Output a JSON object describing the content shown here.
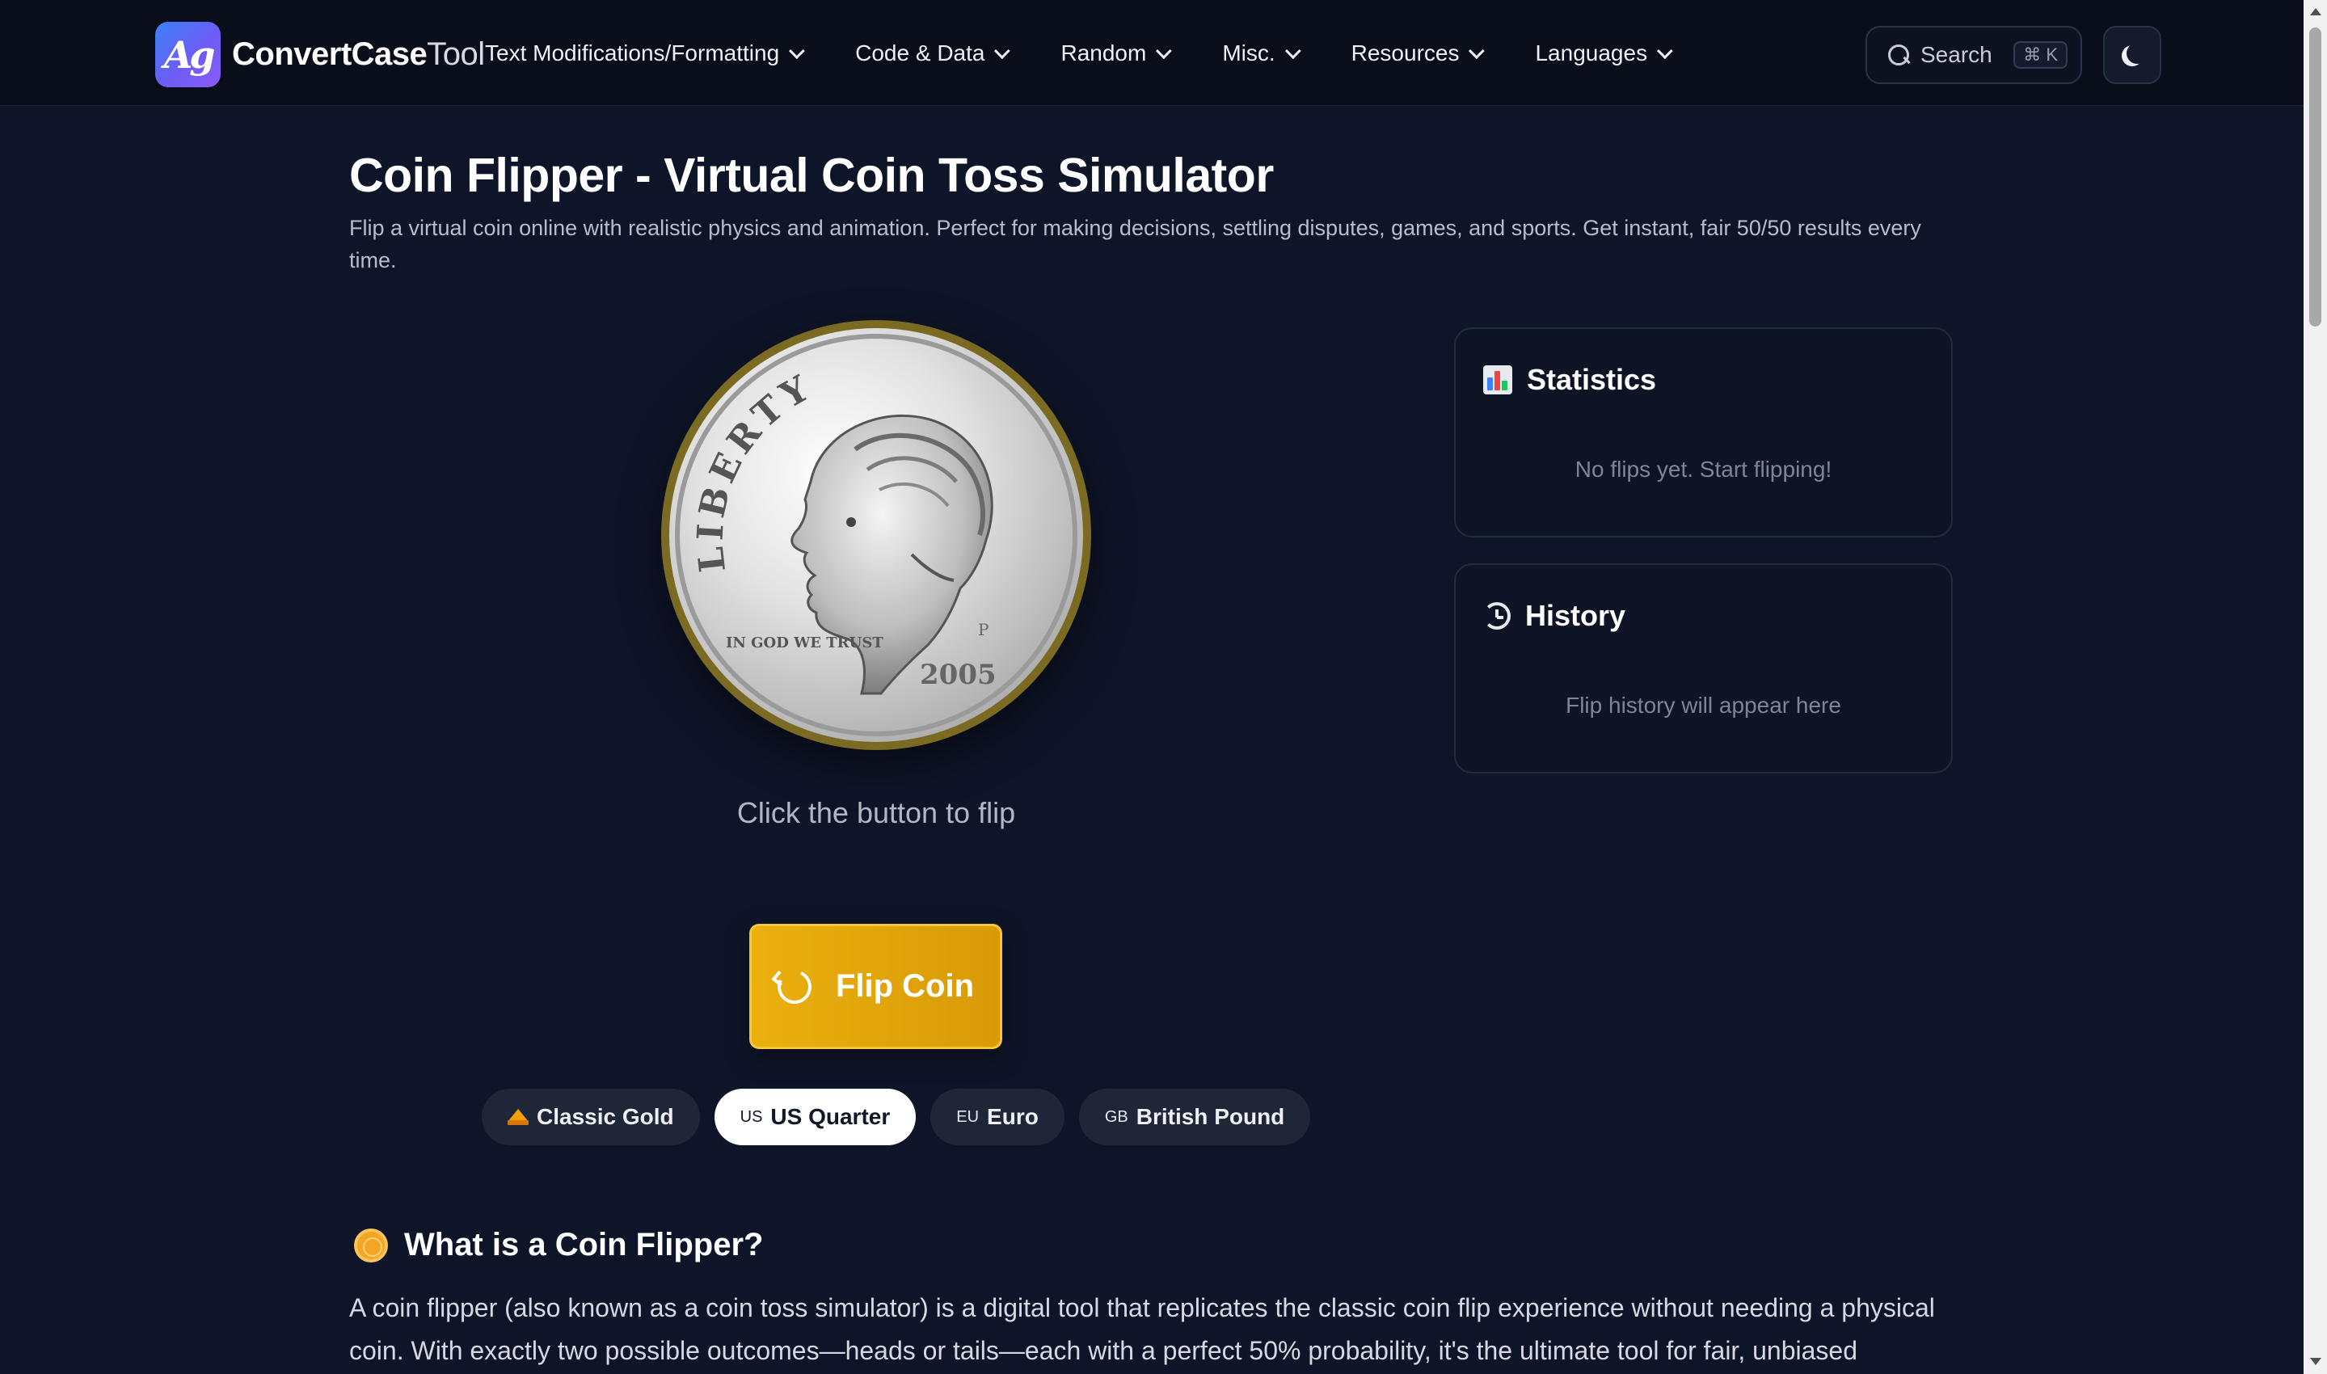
{
  "header": {
    "logo_monogram": "Ag",
    "logo_text_bold": "ConvertCase",
    "logo_text_light": "Tool",
    "nav": [
      {
        "label": "Text Modifications/Formatting"
      },
      {
        "label": "Code & Data"
      },
      {
        "label": "Random"
      },
      {
        "label": "Misc."
      },
      {
        "label": "Resources"
      },
      {
        "label": "Languages"
      }
    ],
    "search_label": "Search",
    "search_shortcut": "⌘ K"
  },
  "page": {
    "title": "Coin Flipper - Virtual Coin Toss Simulator",
    "subtitle": "Flip a virtual coin online with realistic physics and animation. Perfect for making decisions, settling disputes, games, and sports. Get instant, fair 50/50 results every time."
  },
  "coin": {
    "hint": "Click the button to flip",
    "face_text_top": "LIBERTY",
    "face_text_motto": "IN GOD WE TRUST",
    "face_year": "2005",
    "face_mint": "P"
  },
  "flip_button": {
    "label": "Flip Coin"
  },
  "coin_styles": [
    {
      "flag": "",
      "label": "Classic Gold",
      "icon": "crown-icon",
      "active": false
    },
    {
      "flag": "US",
      "label": "US Quarter",
      "active": true
    },
    {
      "flag": "EU",
      "label": "Euro",
      "active": false
    },
    {
      "flag": "GB",
      "label": "British Pound",
      "active": false
    }
  ],
  "statistics": {
    "title": "Statistics",
    "empty": "No flips yet. Start flipping!"
  },
  "history": {
    "title": "History",
    "empty": "Flip history will appear here"
  },
  "what_is": {
    "heading": "What is a Coin Flipper?",
    "body": "A coin flipper (also known as a coin toss simulator) is a digital tool that replicates the classic coin flip experience without needing a physical coin. With exactly two possible outcomes—heads or tails—each with a perfect 50% probability, it's the ultimate tool for fair, unbiased"
  },
  "colors": {
    "background": "#0f1529",
    "header": "#0a0e1a",
    "accent_gold": "#eab00e",
    "coin_rim": "#7a6a22"
  }
}
